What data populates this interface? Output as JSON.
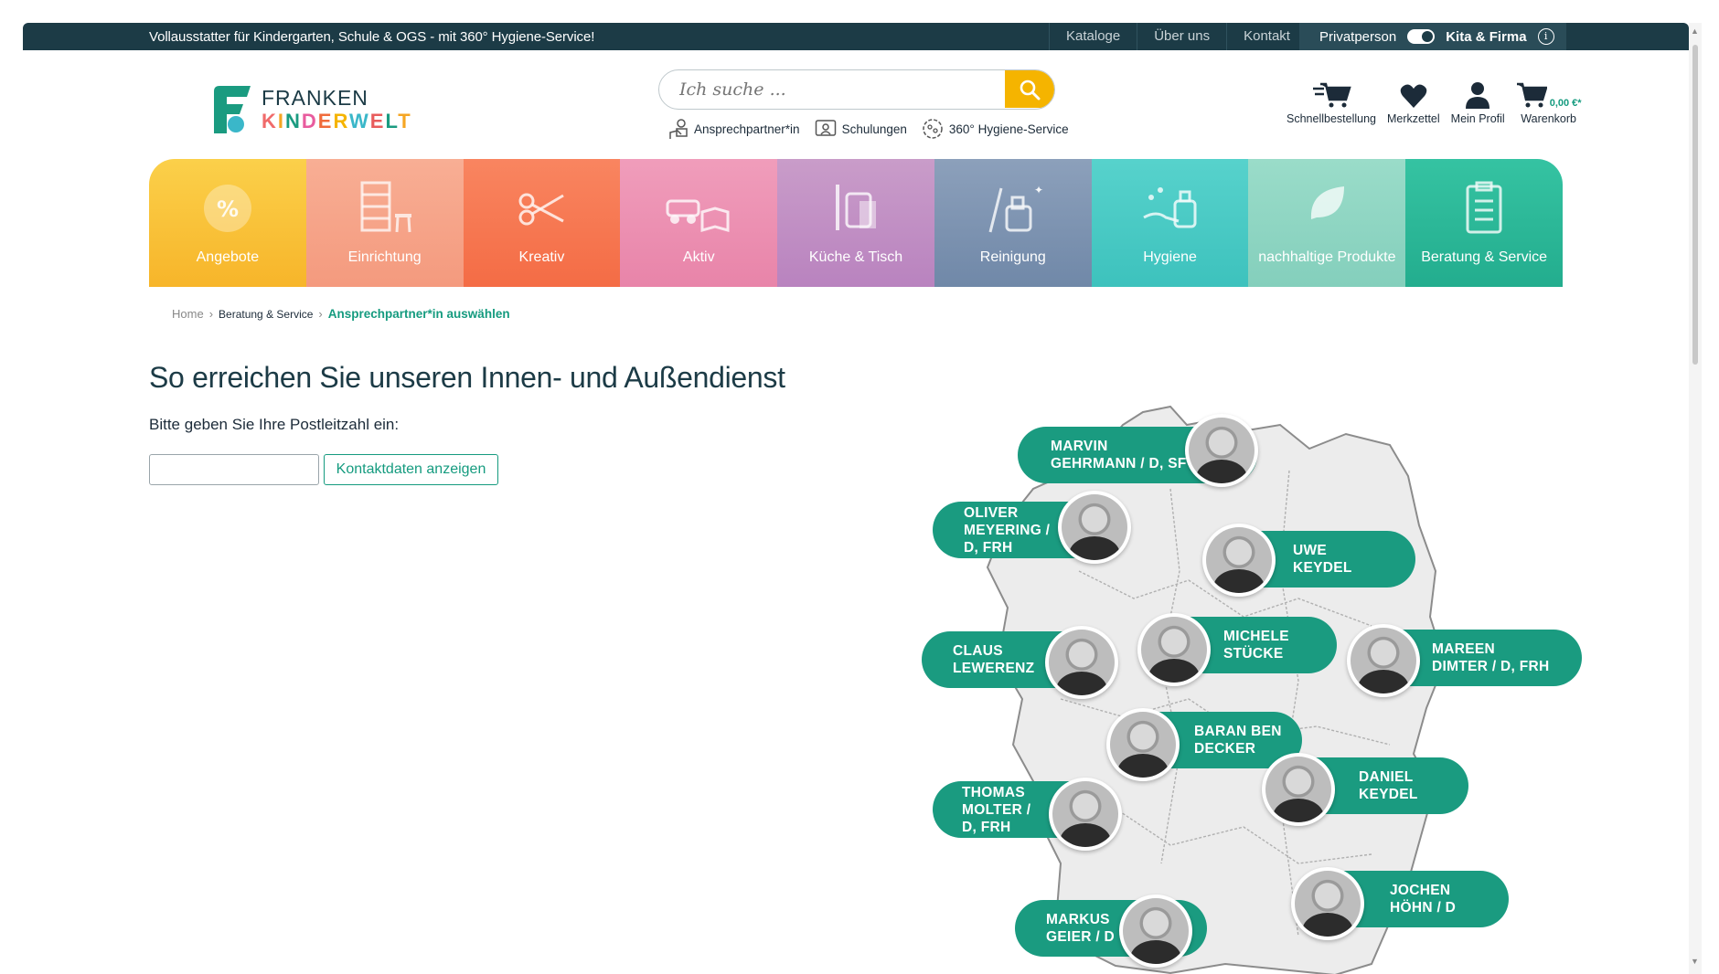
{
  "topbar": {
    "promo": "Vollausstatter für Kindergarten, Schule & OGS - mit 360° Hygiene-Service!",
    "links": [
      "Kataloge",
      "Über uns",
      "Kontakt"
    ],
    "switch_left": "Privatperson",
    "switch_right": "Kita & Firma"
  },
  "logo": {
    "line1": "FRANKEN",
    "line2": "KINDERWELT"
  },
  "search": {
    "placeholder": "Ich suche ..."
  },
  "sublinks": [
    "Ansprechpartner*in",
    "Schulungen",
    "360° Hygiene-Service"
  ],
  "actions": {
    "quick_order": "Schnellbestellung",
    "wishlist": "Merkzettel",
    "profile": "Mein Profil",
    "cart": "Warenkorb",
    "cart_value": "0,00 €*"
  },
  "categories": [
    {
      "label": "Angebote",
      "color": "#f9c23c"
    },
    {
      "label": "Einrichtung",
      "color": "#f6a287"
    },
    {
      "label": "Kreativ",
      "color": "#f7744f"
    },
    {
      "label": "Aktiv",
      "color": "#ec8fb1"
    },
    {
      "label": "Küche & Tisch",
      "color": "#c48fc4"
    },
    {
      "label": "Reinigung",
      "color": "#7f95b2"
    },
    {
      "label": "Hygiene",
      "color": "#46cbc5"
    },
    {
      "label": "nachhaltige Produkte",
      "color": "#8fd6c4"
    },
    {
      "label": "Beratung & Service",
      "color": "#2bb998"
    }
  ],
  "breadcrumb": {
    "home": "Home",
    "section": "Beratung & Service",
    "current": "Ansprechpartner*in auswählen"
  },
  "main": {
    "title": "So erreichen Sie unseren Innen- und Außendienst",
    "prompt": "Bitte geben Sie Ihre Postleitzahl ein:",
    "button": "Kontaktdaten anzeigen"
  },
  "contacts": [
    {
      "name": "MARVIN\nGEHRMANN / D, SF"
    },
    {
      "name": "OLIVER\nMEYERING /\nD, FRH"
    },
    {
      "name": "UWE\nKEYDEL"
    },
    {
      "name": "CLAUS\nLEWERENZ"
    },
    {
      "name": "MICHELE\nSTÜCKE"
    },
    {
      "name": "MAREEN\nDIMTER / D, FRH"
    },
    {
      "name": "BARAN BEN\nDECKER"
    },
    {
      "name": "DANIEL\nKEYDEL"
    },
    {
      "name": "THOMAS\nMOLTER /\nD, FRH"
    },
    {
      "name": "JOCHEN\nHÖHN / D"
    },
    {
      "name": "MARKUS\nGEIER / D"
    }
  ],
  "colors": {
    "brand_dark": "#1c3b46",
    "accent_green": "#159b7f",
    "search_yellow": "#f5b400"
  }
}
